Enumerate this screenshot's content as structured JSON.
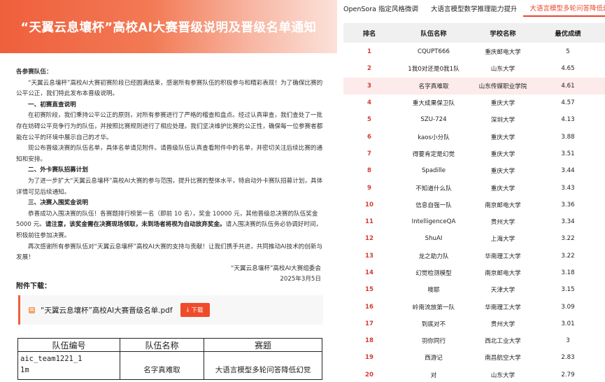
{
  "banner": {
    "title": "“天翼云息壤杯”高校AI大赛晋级说明及晋级名单通知"
  },
  "notice": {
    "salutation": "各参赛队伍：",
    "intro": "“天翼云息壤杯”高校AI大赛初赛阶段已经圆满结束，感谢所有参赛队伍的积极参与和精彩表现！为了确保比赛的公平公正，我们特此发布本晋级说明。",
    "s1_heading": "一、初赛直查说明",
    "s1_p1": "在初赛阶段，我们秉持公平公正的原则，对所有参赛进行了严格的稽查和盘点。经过认真审查，我们查处了一批存在妨碍公平竞争行为的队伍，并按照比赛规则进行了相应处理。我们坚决维护比赛的公正性，确保每一位参赛者都能在公平的环境中展示自己的才华。",
    "s1_p2": "现公布晋级决赛的队伍名单，具体名单请见附件。请晋级队伍认真查看附件中的名单，并密切关注后续比赛的通知和安排。",
    "s2_heading": "二、外卡赛队招募计划",
    "s2_p1": "为了进一步扩大“天翼云息壤杯”高校AI大赛的参与范围，提升比赛的整体水平，特启动外卡赛队招募计划，具体详情可见后续通知。",
    "s3_heading": "三、决赛入围奖金说明",
    "s3_p1_a": "恭喜成功入围决赛的队伍！各赛题排行榜第一名（即前 10 名），奖金 10000 元，其他晋级总决赛的队伍奖金 5000 元。",
    "s3_p1_b": "请注意，该奖金需在决赛现场领取，未到场者将视为自动放弃奖金。",
    "s3_p1_c": "请入围决赛的队伍务必协调好时间，积极前往参加决赛。",
    "closing": "再次感谢所有参赛队伍对“天翼云息壤杯”高校AI大赛的支持与贡献！让我们携手共进，共同推动AI技术的创新与发展！",
    "signature": "“天翼云息壤杯”高校AI大赛组委会",
    "date": "2025年3月5日"
  },
  "attachment": {
    "title": "附件下载：",
    "file_name": "“天翼云息壤杯”高校AI大赛晋级名单.pdf",
    "download_label": "下载",
    "download_icon": "download-arrow-icon"
  },
  "doc_table": {
    "headers": [
      "队伍编号",
      "队伍名称",
      "赛题"
    ],
    "row": {
      "team_id_line1": "aic_team1221_1",
      "team_id_line2": "1m",
      "team_name": "名字真难取",
      "task": "大语言模型多轮问答降低幻觉"
    }
  },
  "tabs": [
    "OpenSora 指定风格微调",
    "大语言模型数学推理能力提升",
    "大语言模型多轮问答降低幻觉"
  ],
  "active_tab": 2,
  "leaderboard": {
    "headers": {
      "rank": "排名",
      "team": "队伍名称",
      "school": "学校名称",
      "score": "最优成绩"
    },
    "highlight_rank": 3,
    "highlight_color": "#fdeaea",
    "rank_color": "#d63b2f",
    "rows": [
      {
        "rank": "1",
        "team": "CQUPT666",
        "school": "重庆邮电大学",
        "score": "5"
      },
      {
        "rank": "2",
        "team": "1我0对还是0我1队",
        "school": "山东大学",
        "score": "4.65"
      },
      {
        "rank": "3",
        "team": "名字真难取",
        "school": "山东传媒职业学院",
        "score": "4.61"
      },
      {
        "rank": "4",
        "team": "重大成果保卫队",
        "school": "重庆大学",
        "score": "4.57"
      },
      {
        "rank": "5",
        "team": "SZU-724",
        "school": "深圳大学",
        "score": "4.13"
      },
      {
        "rank": "6",
        "team": "kaos小分队",
        "school": "重庆大学",
        "score": "3.88"
      },
      {
        "rank": "7",
        "team": "得要肯定是幻觉",
        "school": "重庆大学",
        "score": "3.51"
      },
      {
        "rank": "8",
        "team": "Spadille",
        "school": "重庆大学",
        "score": "3.44"
      },
      {
        "rank": "9",
        "team": "不知道什么队",
        "school": "重庆大学",
        "score": "3.43"
      },
      {
        "rank": "10",
        "team": "信息自强一队",
        "school": "南京邮电大学",
        "score": "3.36"
      },
      {
        "rank": "11",
        "team": "IntelligenceQA",
        "school": "贵州大学",
        "score": "3.34"
      },
      {
        "rank": "12",
        "team": "ShuAI",
        "school": "上海大学",
        "score": "3.22"
      },
      {
        "rank": "13",
        "team": "龙之助力队",
        "school": "华南理工大学",
        "score": "3.22"
      },
      {
        "rank": "14",
        "team": "幻觉检测模型",
        "school": "南京邮电大学",
        "score": "3.18"
      },
      {
        "rank": "15",
        "team": "噢耶",
        "school": "天津大学",
        "score": "3.15"
      },
      {
        "rank": "16",
        "team": "岭南流放第一队",
        "school": "华南理工大学",
        "score": "3.09"
      },
      {
        "rank": "17",
        "team": "到底对不",
        "school": "贵州大学",
        "score": "3.01"
      },
      {
        "rank": "18",
        "team": "羽你同行",
        "school": "西北工业大学",
        "score": "3"
      },
      {
        "rank": "19",
        "team": "西游记",
        "school": "南昌航空大学",
        "score": "2.83"
      },
      {
        "rank": "20",
        "team": "对",
        "school": "山东大学",
        "score": "2.79"
      }
    ]
  }
}
